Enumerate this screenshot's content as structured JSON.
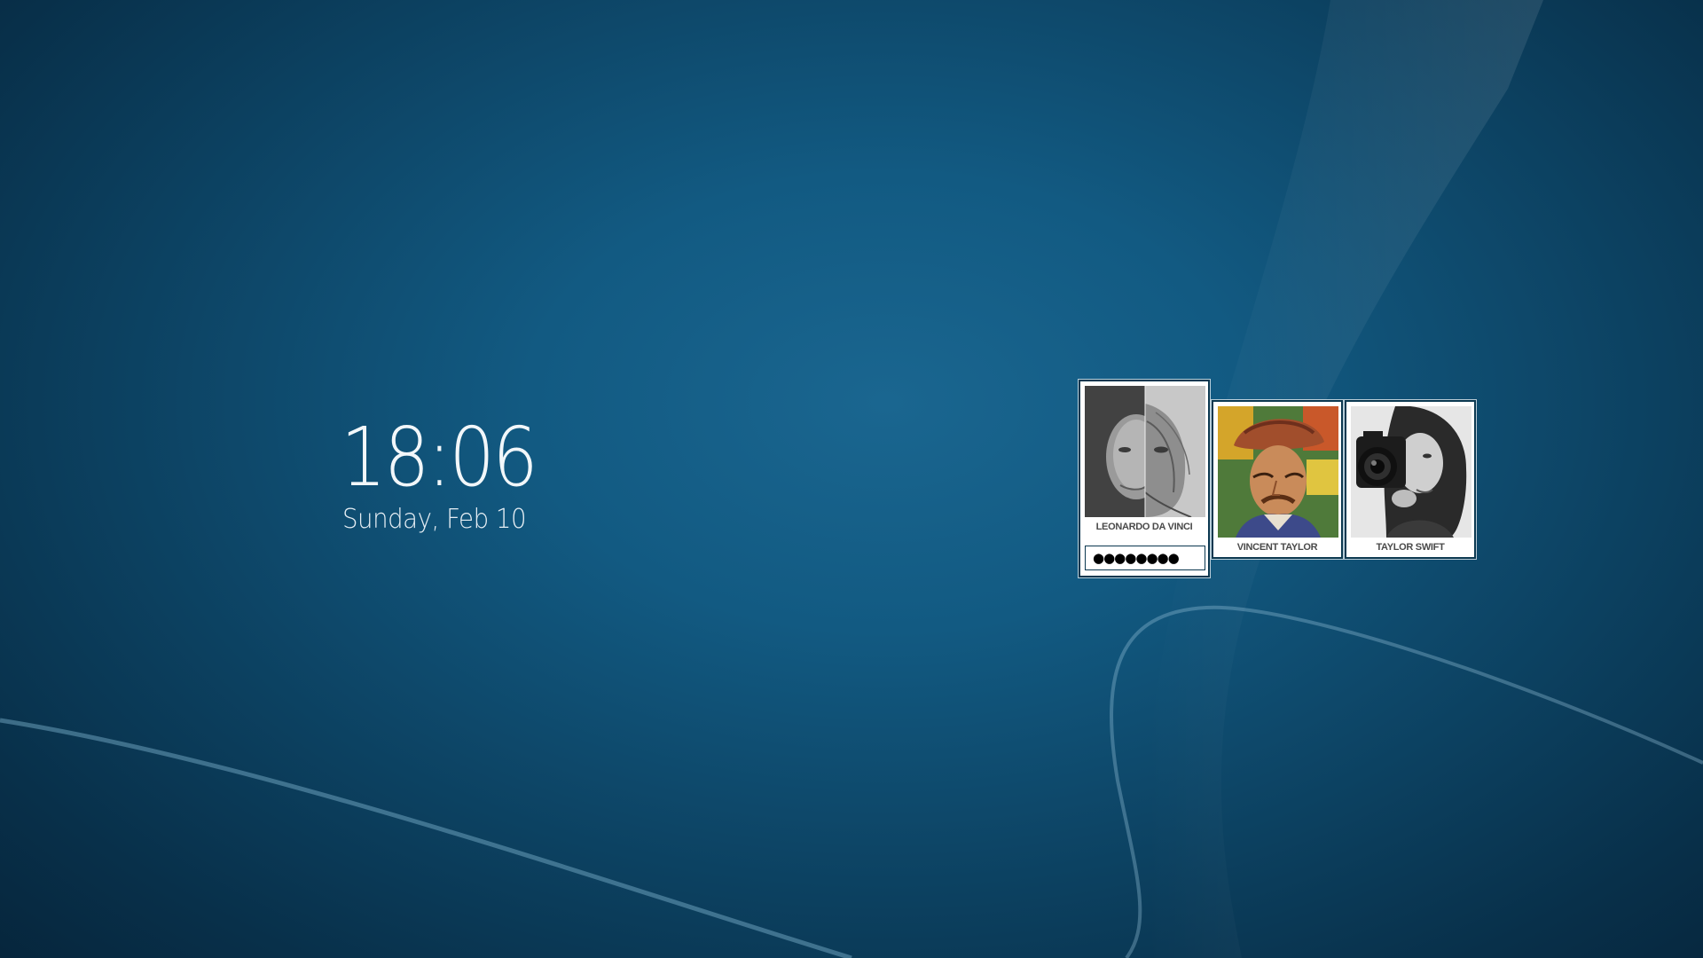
{
  "clock": {
    "time": "18:06",
    "date": "Sunday, Feb 10"
  },
  "users": [
    {
      "name": "LEONARDO DA VINCI",
      "selected": true,
      "avatar_icon": "mona-lisa-da-vinci-avatar"
    },
    {
      "name": "VINCENT TAYLOR",
      "selected": false,
      "avatar_icon": "painted-portrait-avatar"
    },
    {
      "name": "TAYLOR SWIFT",
      "selected": false,
      "avatar_icon": "camera-portrait-avatar"
    }
  ],
  "password": {
    "masked_value": "●●●●●●●●"
  },
  "colors": {
    "background": "#125a82",
    "tile_border": "#0b3850",
    "name_text": "#4a4a4a"
  }
}
